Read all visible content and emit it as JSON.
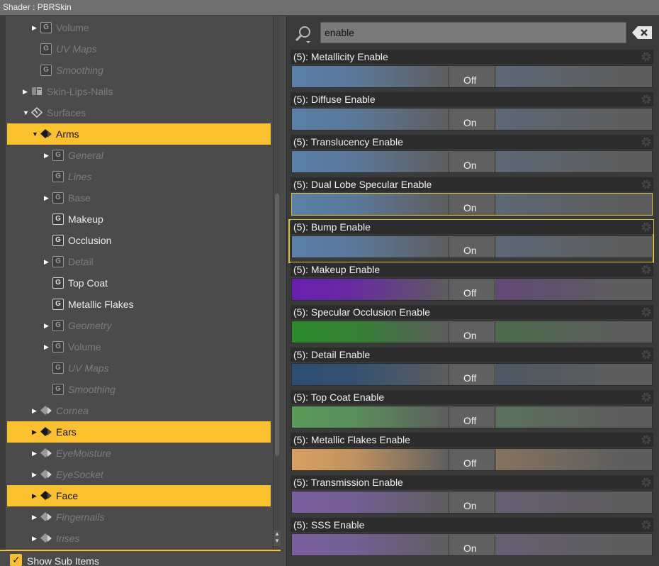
{
  "window": {
    "title": "Shader : PBRSkin"
  },
  "tree": {
    "rows": [
      {
        "label": "Volume",
        "expand": true,
        "icon": "group-icon",
        "style": "dimmed",
        "indent": 1
      },
      {
        "label": "UV Maps",
        "expand": false,
        "icon": "group-icon",
        "style": "italic",
        "indent": 1
      },
      {
        "label": "Smoothing",
        "expand": false,
        "icon": "group-icon",
        "style": "italic",
        "indent": 1
      },
      {
        "label": "Skin-Lips-Nails",
        "expand": true,
        "icon": "node-icon",
        "style": "dimmed",
        "indent": 0
      },
      {
        "label": "Surfaces",
        "expand": "open",
        "icon": "surfaces-icon",
        "style": "dimmed",
        "indent": 0
      },
      {
        "label": "Arms",
        "expand": "open",
        "icon": "surface-icon",
        "style": "normal",
        "indent": 1,
        "selected": true
      },
      {
        "label": "General",
        "expand": true,
        "icon": "group-icon",
        "style": "italic",
        "indent": 2
      },
      {
        "label": "Lines",
        "expand": false,
        "icon": "group-icon",
        "style": "italic",
        "indent": 2
      },
      {
        "label": "Base",
        "expand": true,
        "icon": "group-icon",
        "style": "dimmed",
        "indent": 2
      },
      {
        "label": "Makeup",
        "expand": false,
        "icon": "group-icon",
        "style": "normal",
        "indent": 2
      },
      {
        "label": "Occlusion",
        "expand": false,
        "icon": "group-icon",
        "style": "normal",
        "indent": 2
      },
      {
        "label": "Detail",
        "expand": true,
        "icon": "group-icon",
        "style": "dimmed",
        "indent": 2
      },
      {
        "label": "Top Coat",
        "expand": false,
        "icon": "group-icon",
        "style": "normal",
        "indent": 2
      },
      {
        "label": "Metallic Flakes",
        "expand": false,
        "icon": "group-icon",
        "style": "normal",
        "indent": 2
      },
      {
        "label": "Geometry",
        "expand": true,
        "icon": "group-icon",
        "style": "italic",
        "indent": 2
      },
      {
        "label": "Volume",
        "expand": true,
        "icon": "group-icon",
        "style": "dimmed",
        "indent": 2
      },
      {
        "label": "UV Maps",
        "expand": false,
        "icon": "group-icon",
        "style": "italic",
        "indent": 2
      },
      {
        "label": "Smoothing",
        "expand": false,
        "icon": "group-icon",
        "style": "italic",
        "indent": 2
      },
      {
        "label": "Cornea",
        "expand": true,
        "icon": "surface-icon",
        "style": "italic",
        "indent": 1
      },
      {
        "label": "Ears",
        "expand": true,
        "icon": "surface-icon",
        "style": "normal",
        "indent": 1,
        "selected": true
      },
      {
        "label": "EyeMoisture",
        "expand": true,
        "icon": "surface-icon",
        "style": "italic",
        "indent": 1
      },
      {
        "label": "EyeSocket",
        "expand": true,
        "icon": "surface-icon",
        "style": "italic",
        "indent": 1
      },
      {
        "label": "Face",
        "expand": true,
        "icon": "surface-icon",
        "style": "normal",
        "indent": 1,
        "selected": true
      },
      {
        "label": "Fingernails",
        "expand": true,
        "icon": "surface-icon",
        "style": "italic",
        "indent": 1
      },
      {
        "label": "Irises",
        "expand": true,
        "icon": "surface-icon",
        "style": "italic",
        "indent": 1
      }
    ],
    "group_glyph": "G"
  },
  "bottom": {
    "show_sub_items_label": "Show Sub Items",
    "show_sub_items_checked": true
  },
  "search": {
    "value": "enable",
    "placeholder": ""
  },
  "properties": [
    {
      "name": "(5): Metallicity Enable",
      "value": "Off",
      "color": "#5a7fa8"
    },
    {
      "name": "(5): Diffuse Enable",
      "value": "On",
      "color": "#5a7fa8"
    },
    {
      "name": "(5): Translucency Enable",
      "value": "On",
      "color": "#5a7fa8"
    },
    {
      "name": "(5): Dual Lobe Specular Enable",
      "value": "On",
      "color": "#5a7fa8",
      "highlight": "slider"
    },
    {
      "name": "(5): Bump Enable",
      "value": "On",
      "color": "#5a7fa8",
      "highlight": "outline"
    },
    {
      "name": "(5): Makeup Enable",
      "value": "Off",
      "color": "#6a1fb0"
    },
    {
      "name": "(5): Specular Occlusion Enable",
      "value": "On",
      "color": "#2a8a2a"
    },
    {
      "name": "(5): Detail Enable",
      "value": "Off",
      "color": "#2c4e74"
    },
    {
      "name": "(5): Top Coat Enable",
      "value": "Off",
      "color": "#5a9a5a"
    },
    {
      "name": "(5): Metallic Flakes Enable",
      "value": "Off",
      "color": "#d9a060"
    },
    {
      "name": "(5): Transmission Enable",
      "value": "On",
      "color": "#7a5fa0"
    },
    {
      "name": "(5): SSS Enable",
      "value": "On",
      "color": "#7a5fa0"
    }
  ]
}
